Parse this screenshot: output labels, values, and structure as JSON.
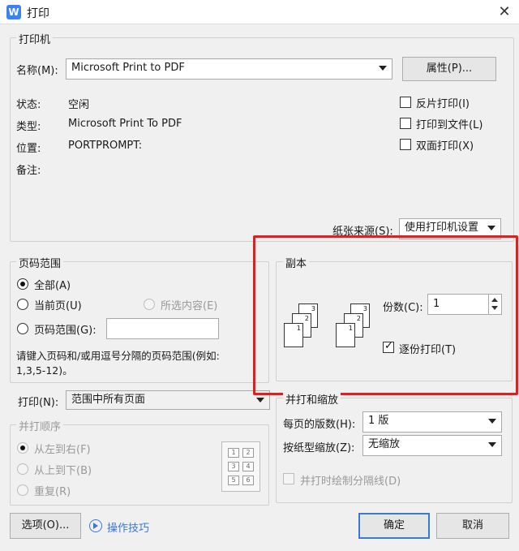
{
  "window": {
    "title": "打印",
    "app_icon": "W",
    "close": "✕"
  },
  "printer": {
    "group_title": "打印机",
    "name_label": "名称(M):",
    "name_value": "Microsoft Print to PDF",
    "properties_btn": "属性(P)...",
    "status_label": "状态:",
    "status_value": "空闲",
    "type_label": "类型:",
    "type_value": "Microsoft Print To PDF",
    "location_label": "位置:",
    "location_value": "PORTPROMPT:",
    "comment_label": "备注:",
    "comment_value": "",
    "reverse_print": "反片打印(I)",
    "print_to_file": "打印到文件(L)",
    "duplex": "双面打印(X)",
    "paper_source_label": "纸张来源(S):",
    "paper_source_value": "使用打印机设置"
  },
  "page_range": {
    "group_title": "页码范围",
    "all": "全部(A)",
    "current": "当前页(U)",
    "selection": "所选内容(E)",
    "pages": "页码范围(G):",
    "pages_value": "",
    "hint": "请键入页码和/或用逗号分隔的页码范围(例如:",
    "hint_example": "1,3,5-12)。"
  },
  "print_what": {
    "label": "打印(N):",
    "value": "范围中所有页面"
  },
  "collate_order": {
    "group_title": "并打顺序",
    "left_to_right": "从左到右(F)",
    "top_to_bottom": "从上到下(B)",
    "repeat": "重复(R)",
    "cells": [
      "1",
      "2",
      "3",
      "4",
      "5",
      "6"
    ]
  },
  "copies": {
    "group_title": "副本",
    "count_label": "份数(C):",
    "count_value": "1",
    "collate": "逐份打印(T)",
    "page_numbers": [
      "3",
      "2",
      "1"
    ]
  },
  "zoom": {
    "group_title": "并打和缩放",
    "pages_per_sheet_label": "每页的版数(H):",
    "pages_per_sheet_value": "1 版",
    "scale_label": "按纸型缩放(Z):",
    "scale_value": "无缩放",
    "draw_borders": "并打时绘制分隔线(D)"
  },
  "footer": {
    "options_btn": "选项(O)...",
    "tips_link": "操作技巧",
    "ok_btn": "确定",
    "cancel_btn": "取消"
  },
  "colors": {
    "accent": "#3a78d6",
    "highlight_box": "#e02020"
  }
}
